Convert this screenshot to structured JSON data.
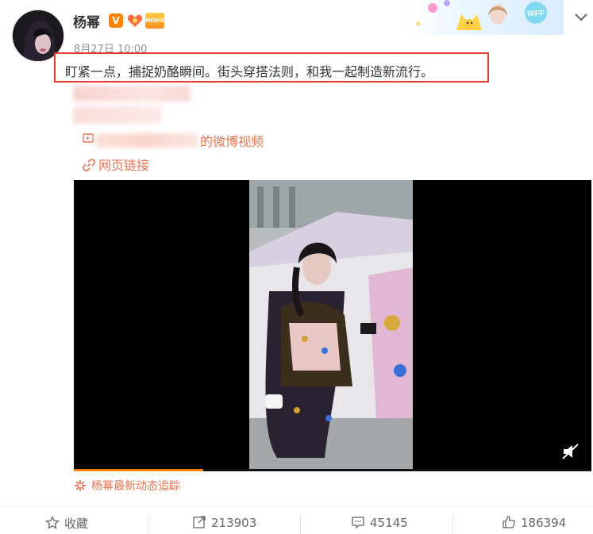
{
  "post": {
    "username": "杨幂",
    "verified_badge": "V",
    "movie_badge": "MOVIE",
    "timestamp": "8月27日 10:00",
    "text": "盯紧一点，捕捉奶酪瞬间。街头穿搭法则，和我一起制造新流行。",
    "video_source_suffix": "的微博视频",
    "webpage_link_label": "网页链接",
    "track_label": "杨幂最新动态追踪"
  },
  "banner": {
    "text": "WFF"
  },
  "video": {
    "progress": 0.25,
    "background": "#000000"
  },
  "actions": {
    "favorite_label": "收藏",
    "repost_count": "213903",
    "comment_count": "45145",
    "like_count": "186394"
  },
  "colors": {
    "link": "#eb7350",
    "highlight_border": "#e4392f",
    "verified": "#ff8200",
    "progress": "#ff8200"
  },
  "icons": [
    "chevron-down-icon",
    "link-icon",
    "video-play-icon",
    "mute-icon",
    "star-icon",
    "repost-icon",
    "comment-icon",
    "like-icon",
    "sparkle-icon"
  ]
}
